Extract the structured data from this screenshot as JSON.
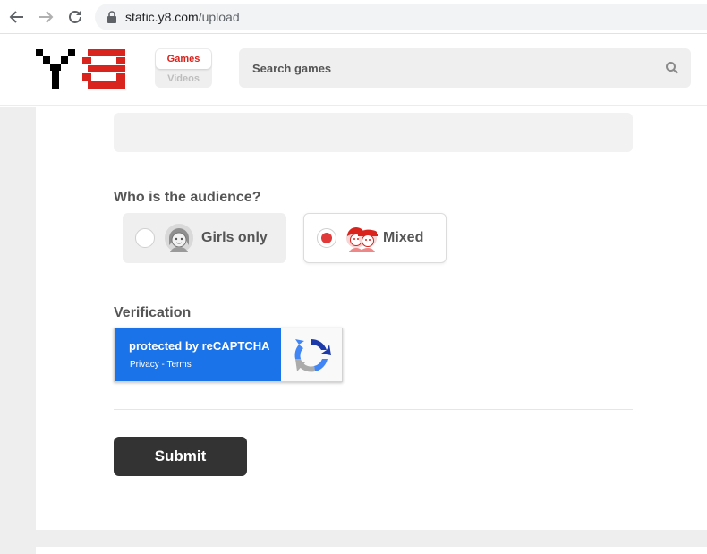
{
  "browser": {
    "url_host": "static.y8.com",
    "url_path": "/upload"
  },
  "header": {
    "switcher": {
      "games_label": "Games",
      "videos_label": "Videos"
    },
    "search": {
      "placeholder": "Search games"
    }
  },
  "form": {
    "audience": {
      "label": "Who is the audience?",
      "options": [
        {
          "label": "Girls only",
          "selected": false
        },
        {
          "label": "Mixed",
          "selected": true
        }
      ]
    },
    "verification": {
      "label": "Verification",
      "recaptcha_text": "protected by reCAPTCHA",
      "recaptcha_links": "Privacy - Terms"
    },
    "submit_label": "Submit"
  },
  "colors": {
    "brand_red": "#d9231d",
    "recaptcha_blue": "#1a73e8",
    "radio_selected": "#e03a3a",
    "submit_bg": "#333333"
  },
  "icons": [
    "back-arrow-icon",
    "forward-arrow-icon",
    "reload-icon",
    "lock-icon",
    "search-icon",
    "girl-avatar-icon",
    "mixed-avatar-icon",
    "recaptcha-logo-icon"
  ]
}
